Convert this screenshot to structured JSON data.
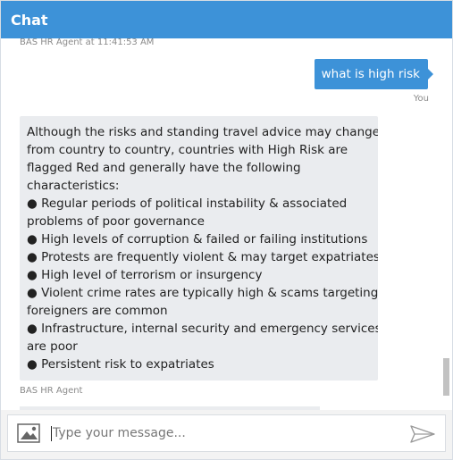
{
  "header": {
    "title": "Chat"
  },
  "transcript": {
    "top_meta": "BAS HR Agent at 11:41:53 AM",
    "user_message": {
      "text": "what is high risk",
      "sender": "You"
    },
    "bot_message": {
      "sender": "BAS HR Agent",
      "lines": [
        "Although the risks and standing travel advice may change",
        "from country to country, countries with High Risk are",
        "flagged Red and generally have the following",
        "characteristics:",
        "● Regular periods of political instability & associated",
        "problems of poor governance",
        "● High levels of corruption & failed or failing institutions",
        "● Protests are frequently violent & may target expatriates",
        "● High level of terrorism or insurgency",
        "● Violent crime rates are typically high & scams targeting",
        "foreigners are common",
        "● Infrastructure, internal security and emergency services",
        "are poor",
        "● Persistent risk to expatriates"
      ]
    }
  },
  "composer": {
    "placeholder": "Type your message...",
    "value": "",
    "upload_icon": "image-upload-icon",
    "send_icon": "send-icon"
  },
  "colors": {
    "accent": "#3d92d8",
    "bot_bubble": "#eaecef",
    "meta_text": "#8a8a8a"
  }
}
